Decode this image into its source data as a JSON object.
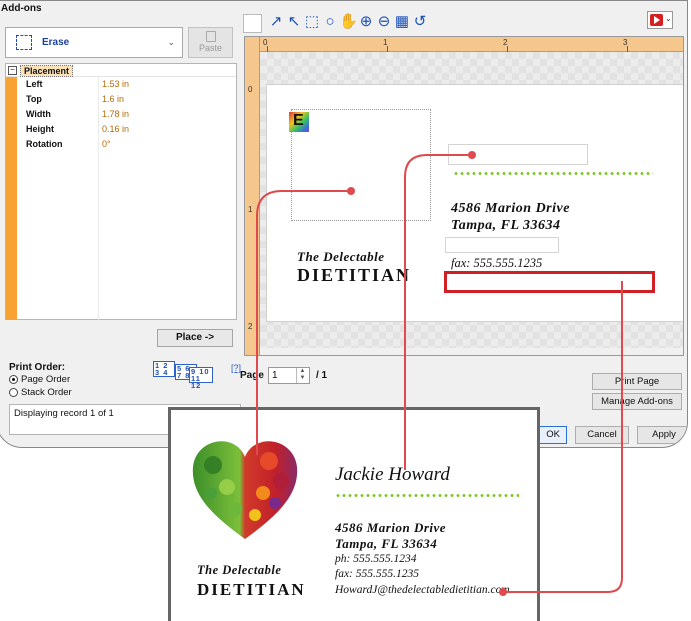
{
  "window": {
    "title": "Add-ons"
  },
  "left_panel": {
    "erase_dropdown": {
      "label": "Erase"
    },
    "paste_label": "Paste",
    "property_grid": {
      "category": "Placement",
      "properties": [
        {
          "name": "Left",
          "value": "1.53 in"
        },
        {
          "name": "Top",
          "value": "1.6 in"
        },
        {
          "name": "Width",
          "value": "1.78 in"
        },
        {
          "name": "Height",
          "value": "0.16 in"
        },
        {
          "name": "Rotation",
          "value": "0°"
        }
      ]
    },
    "place_button": "Place ->",
    "print_order": {
      "title": "Print Order:",
      "options": [
        "Page Order",
        "Stack Order"
      ],
      "selected": "Page Order",
      "help_link": "[?]",
      "icon_numbers": [
        "1 2",
        "3 4",
        "5 6",
        "7 8",
        "9 10",
        "11 12"
      ]
    },
    "status_text": "Displaying record 1 of 1"
  },
  "toolbar": {
    "tools": [
      "pen-icon",
      "pointer-icon",
      "rect-select-icon",
      "lasso-icon",
      "hand-pan-icon",
      "zoom-in-icon",
      "zoom-out-icon",
      "grid-icon",
      "rotate-icon"
    ],
    "glyphs": [
      "↗",
      "↖",
      "⬚",
      "○",
      "✋",
      "⊕",
      "⊖",
      "▦",
      "↺"
    ]
  },
  "ruler": {
    "top_labels": [
      "0",
      "1",
      "2",
      "3"
    ],
    "left_labels": [
      "0",
      "1",
      "2"
    ]
  },
  "canvas_card": {
    "brand_line1": "The Delectable",
    "brand_line2": "DIETITIAN",
    "address_line1": "4586 Marion Drive",
    "address_line2": "Tampa, FL 33634",
    "fax": "fax: 555.555.1235",
    "e_badge": "E"
  },
  "page_nav": {
    "label": "Page",
    "current": "1",
    "total": "/ 1"
  },
  "buttons": {
    "print_page": "Print Page",
    "manage_addons": "Manage Add-ons",
    "ok": "OK",
    "cancel": "Cancel",
    "apply": "Apply"
  },
  "business_card": {
    "name": "Jackie Howard",
    "address_line1": "4586 Marion Drive",
    "address_line2": "Tampa, FL 33634",
    "phone": "ph: 555.555.1234",
    "fax": "fax: 555.555.1235",
    "email": "HowardJ@thedelectabledietitian.com",
    "brand_line1": "The Delectable",
    "brand_line2": "DIETITIAN"
  },
  "colors": {
    "accent_orange": "#f7a233",
    "connector_red": "#e04a4f",
    "highlight_red": "#d11f26",
    "dots_green": "#7ec82c"
  }
}
